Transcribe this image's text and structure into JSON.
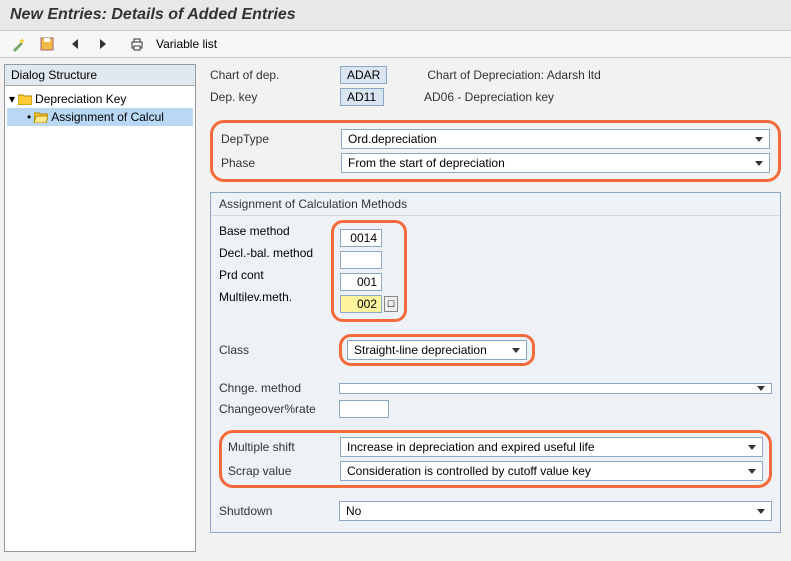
{
  "title": "New Entries: Details of Added Entries",
  "toolbar": {
    "variable_list": "Variable list"
  },
  "tree": {
    "header": "Dialog Structure",
    "root": "Depreciation Key",
    "child": "Assignment of Calcul"
  },
  "header": {
    "chart_label": "Chart of dep.",
    "chart_val": "ADAR",
    "chart_desc": "Chart of Depreciation: Adarsh ltd",
    "key_label": "Dep. key",
    "key_val": "AD11",
    "key_desc": "AD06 - Depreciation key"
  },
  "dep": {
    "type_label": "DepType",
    "type_val": "Ord.depreciation",
    "phase_label": "Phase",
    "phase_val": "From the start of depreciation"
  },
  "calc": {
    "title": "Assignment of Calculation Methods",
    "base_label": "Base method",
    "base_val": "0014",
    "decl_label": "Decl.-bal. method",
    "decl_val": "",
    "prd_label": "Prd cont",
    "prd_val": "001",
    "multi_label": "Multilev.meth.",
    "multi_val": "002",
    "class_label": "Class",
    "class_val": "Straight-line depreciation",
    "chnge_label": "Chnge. method",
    "chnge_val": "",
    "rate_label": "Changeover%rate",
    "rate_val": "",
    "shift_label": "Multiple shift",
    "shift_val": "Increase in depreciation and expired useful life",
    "scrap_label": "Scrap value",
    "scrap_val": "Consideration is controlled by cutoff value key",
    "shutdown_label": "Shutdown",
    "shutdown_val": "No"
  }
}
